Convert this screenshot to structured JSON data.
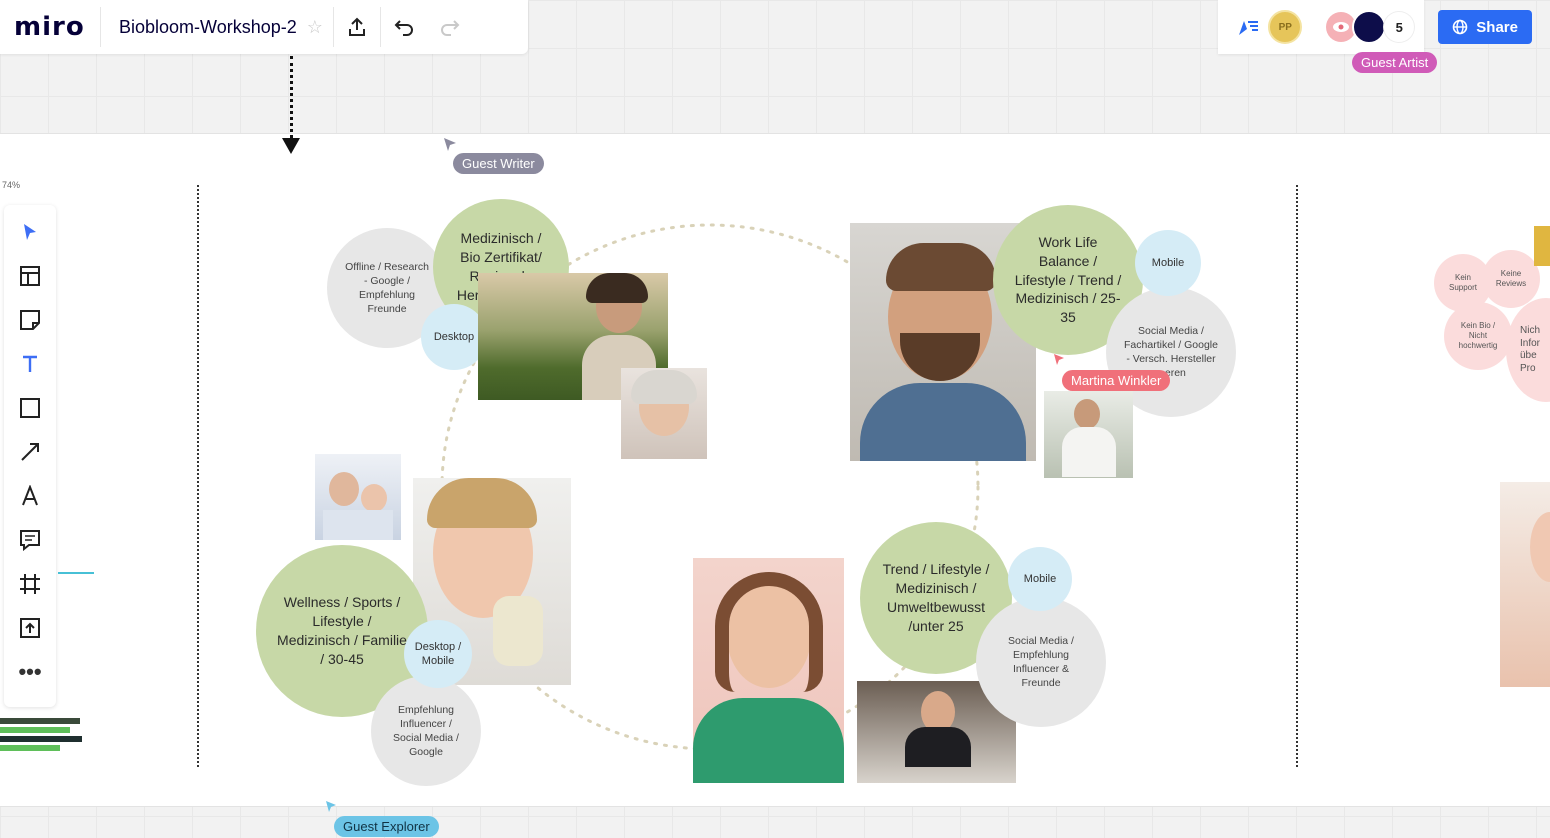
{
  "app": {
    "logo": "miro",
    "board_title": "Biobloom-Workshop-2"
  },
  "topbar": {
    "member_count": "5",
    "share_label": "Share",
    "avatar_initials": "PP"
  },
  "cursors": {
    "guest_writer": "Guest Writer",
    "guest_artist": "Guest Artist",
    "guest_explorer": "Guest Explorer",
    "martina": "Martina Winkler"
  },
  "zoom_fragment": "74%",
  "personas": {
    "p1": {
      "main": "Medizinisch / Bio Zertifikat/ Regionale Herkunft / 40+",
      "source": "Offline / Research - Google / Empfehlung Freunde",
      "device": "Desktop"
    },
    "p2": {
      "main": "Work Life Balance / Lifestyle / Trend / Medizinisch / 25-35",
      "source": "Social Media / Fachartikel / Google - Versch. Hersteller ...eren",
      "device": "Mobile"
    },
    "p3": {
      "main": "Wellness / Sports / Lifestyle / Medizinisch / Familie / 30-45",
      "source": "Empfehlung Influencer / Social Media / Google",
      "device": "Desktop / Mobile"
    },
    "p4": {
      "main": "Trend / Lifestyle / Medizinisch / Umweltbewusst /unter 25",
      "source": "Social Media / Empfehlung Influencer & Freunde",
      "device": "Mobile"
    }
  },
  "right_notes": {
    "n1": "Kein Support",
    "n2": "Keine Reviews",
    "n3": "Kein Bio / Nicht hochwertig",
    "n4": "Nich Infor übe Pro"
  },
  "colors": {
    "accent": "#2b6bf3",
    "green": "#c7d8a7",
    "blue": "#d5ecf6",
    "gray": "#e7e7e7"
  }
}
